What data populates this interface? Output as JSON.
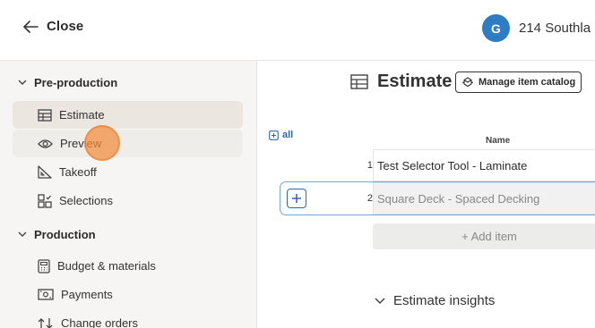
{
  "topbar": {
    "close_label": "Close",
    "avatar_initial": "G",
    "project_name": "214 Southla"
  },
  "sidebar": {
    "preproduction": {
      "label": "Pre-production",
      "items": [
        {
          "label": "Estimate",
          "icon": "table-icon",
          "state": "active"
        },
        {
          "label": "Preview",
          "icon": "eye-icon",
          "state": "hover"
        },
        {
          "label": "Takeoff",
          "icon": "ruler-icon",
          "state": ""
        },
        {
          "label": "Selections",
          "icon": "selections-icon",
          "state": ""
        }
      ]
    },
    "production": {
      "label": "Production",
      "items": [
        {
          "label": "Budget & materials",
          "icon": "calculator-icon"
        },
        {
          "label": "Payments",
          "icon": "cash-icon"
        },
        {
          "label": "Change orders",
          "icon": "change-orders-icon"
        }
      ]
    }
  },
  "main": {
    "title": "Estimate",
    "manage_catalog_label": "Manage item catalog",
    "all_label": "all",
    "column_name": "Name",
    "rows": [
      {
        "num": "1",
        "name": "Test Selector Tool - Laminate"
      },
      {
        "num": "2",
        "name": "Square Deck - Spaced Decking"
      }
    ],
    "add_item_label": "+ Add item",
    "insights_label": "Estimate insights"
  },
  "colors": {
    "accent_blue": "#2e67b8",
    "avatar_blue": "#2f7cc4",
    "cursor_orange": "#f28c3c",
    "sidebar_bg": "#f6f5f3"
  }
}
